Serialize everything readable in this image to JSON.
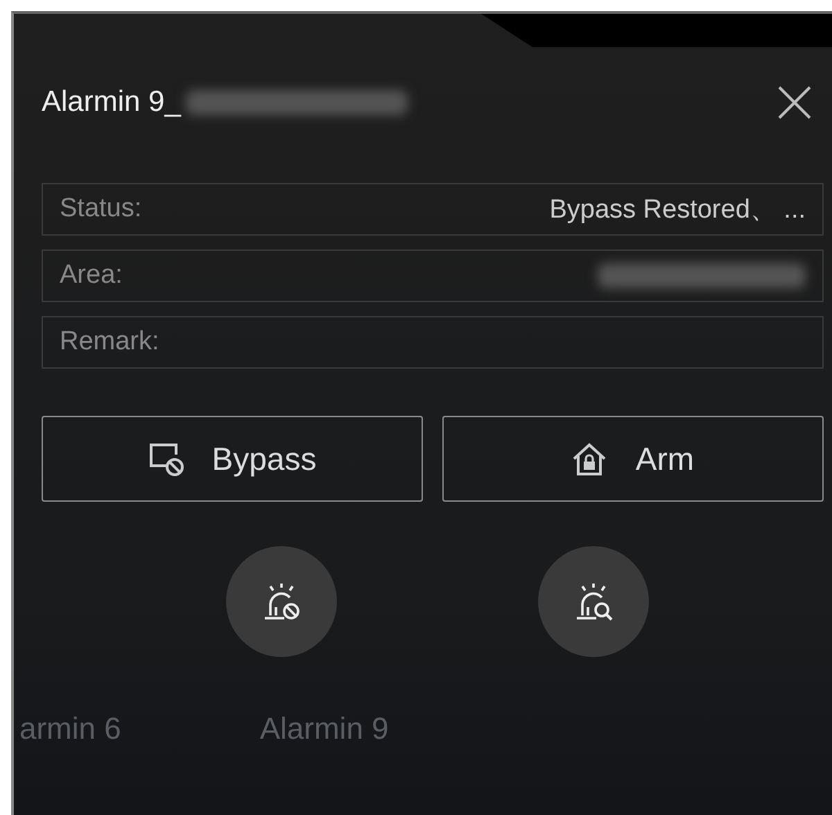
{
  "dialog": {
    "title": "Alarmin 9_",
    "title_redacted": true
  },
  "fields": [
    {
      "label": "Status:",
      "value": "Bypass Restored、 ...",
      "redacted": false
    },
    {
      "label": "Area:",
      "redacted": true
    },
    {
      "label": "Remark:",
      "redacted": false
    }
  ],
  "buttons": [
    {
      "label": "Bypass",
      "kind": "bypass"
    },
    {
      "label": "Arm",
      "kind": "arm"
    }
  ],
  "round_actions": [
    {
      "kind": "siren-bypass"
    },
    {
      "kind": "siren-search"
    }
  ],
  "background_labels": [
    "armin 6",
    "Alarmin 9"
  ]
}
